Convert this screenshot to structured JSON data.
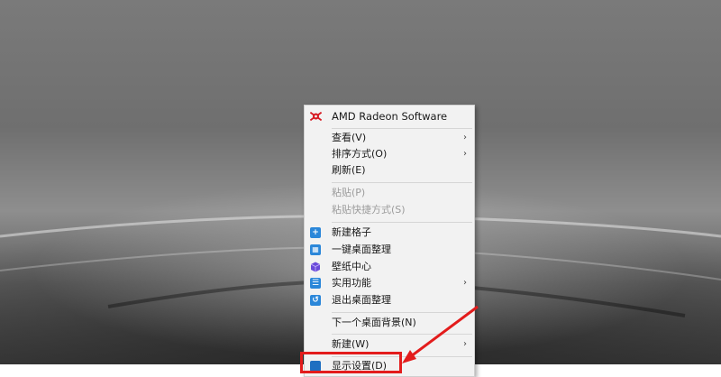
{
  "menu": {
    "header": {
      "label": "AMD Radeon Software",
      "icon": "amd-radeon-icon"
    },
    "view": {
      "label": "查看(V)"
    },
    "sort": {
      "label": "排序方式(O)"
    },
    "refresh": {
      "label": "刷新(E)"
    },
    "paste": {
      "label": "粘贴(P)"
    },
    "paste_shortcut": {
      "label": "粘贴快捷方式(S)"
    },
    "new_grid": {
      "label": "新建格子",
      "icon": "plus-icon",
      "color": "#2b87d9"
    },
    "one_key_arrange": {
      "label": "一键桌面整理",
      "icon": "grid-icon",
      "color": "#2b87d9"
    },
    "wallpaper_center": {
      "label": "壁纸中心",
      "icon": "cube-icon",
      "color": "#6a4bd9"
    },
    "utilities": {
      "label": "实用功能",
      "icon": "list-icon",
      "color": "#2b87d9"
    },
    "exit_arrange": {
      "label": "退出桌面整理",
      "icon": "undo-icon",
      "color": "#2b87d9"
    },
    "next_background": {
      "label": "下一个桌面背景(N)"
    },
    "new": {
      "label": "新建(W)"
    },
    "display_settings": {
      "label": "显示设置(D)",
      "icon": "display-icon"
    }
  },
  "annotation": {
    "color": "#e31c1c"
  }
}
